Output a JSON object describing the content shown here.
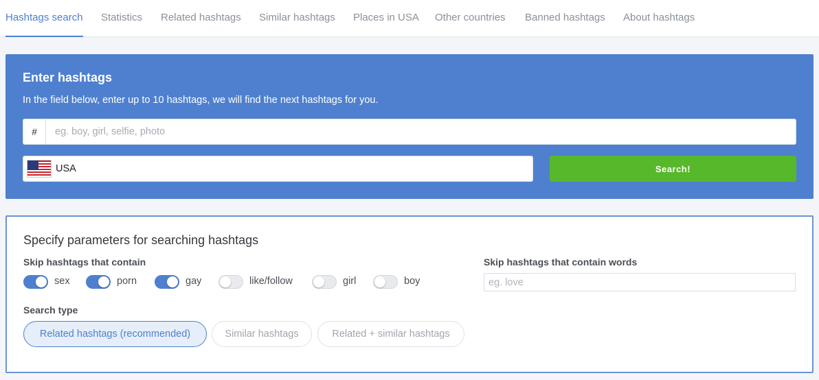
{
  "nav": {
    "tabs": [
      {
        "label": "Hashtags search",
        "active": true
      },
      {
        "label": "Statistics"
      },
      {
        "label": "Related hashtags"
      },
      {
        "label": "Similar hashtags"
      },
      {
        "label": "Places in USA"
      },
      {
        "label": "Other countries"
      },
      {
        "label": "Banned hashtags"
      },
      {
        "label": "About hashtags"
      }
    ]
  },
  "hero": {
    "title": "Enter hashtags",
    "description": "In the field below, enter up to 10 hashtags, we will find the next hashtags for you.",
    "hash_prefix": "#",
    "input_placeholder": "eg. boy, girl, selfie, photo",
    "input_value": "",
    "country": "USA",
    "search_label": "Search!"
  },
  "params": {
    "title": "Specify parameters for searching hashtags",
    "skip_label": "Skip hashtags that contain",
    "toggles": [
      {
        "label": "sex",
        "on": true
      },
      {
        "label": "porn",
        "on": true
      },
      {
        "label": "gay",
        "on": true
      },
      {
        "label": "like/follow",
        "on": false
      },
      {
        "label": "girl",
        "on": false
      },
      {
        "label": "boy",
        "on": false
      }
    ],
    "words_label": "Skip hashtags that contain words",
    "words_placeholder": "eg. love",
    "words_value": "",
    "type_label": "Search type",
    "types": [
      {
        "label": "Related hashtags (recommended)",
        "active": true
      },
      {
        "label": "Similar hashtags",
        "active": false
      },
      {
        "label": "Related + similar hashtags",
        "active": false
      }
    ]
  },
  "colors": {
    "accent": "#4e80cf",
    "search_button": "#58b82b",
    "hero_background": "#4e80cf"
  },
  "icons": {
    "country_flag": "us-flag-icon"
  }
}
